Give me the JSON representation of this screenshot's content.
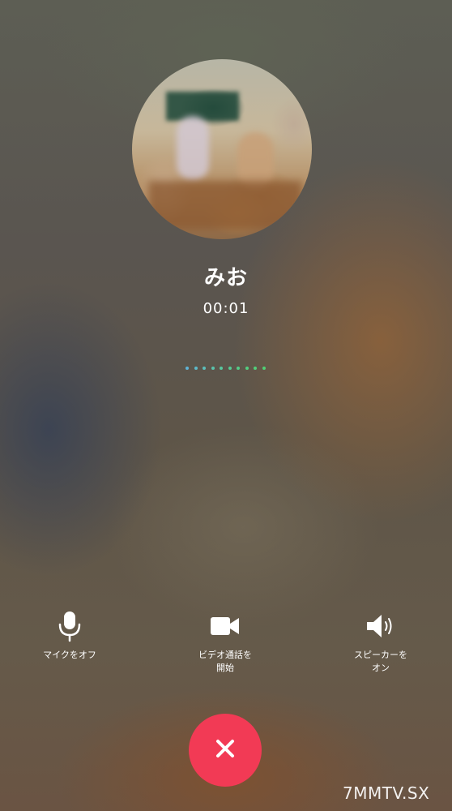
{
  "call": {
    "caller_name": "みお",
    "duration": "00:01",
    "connecting_dots_colors": [
      "#5fb4d6",
      "#5dbac9",
      "#5bbfbb",
      "#59c4ad",
      "#57c89f",
      "#55cb93",
      "#53cd88",
      "#52cf80",
      "#51d07a",
      "#50d175"
    ]
  },
  "controls": {
    "mic": {
      "label": "マイクをオフ",
      "icon": "microphone-icon"
    },
    "video": {
      "label_line1": "ビデオ通話を",
      "label_line2": "開始",
      "icon": "video-camera-icon"
    },
    "speaker": {
      "label_line1": "スピーカーを",
      "label_line2": "オン",
      "icon": "speaker-icon"
    }
  },
  "end_call": {
    "icon": "close-icon",
    "color": "#f23a55"
  },
  "watermark": "7MMTV.SX"
}
